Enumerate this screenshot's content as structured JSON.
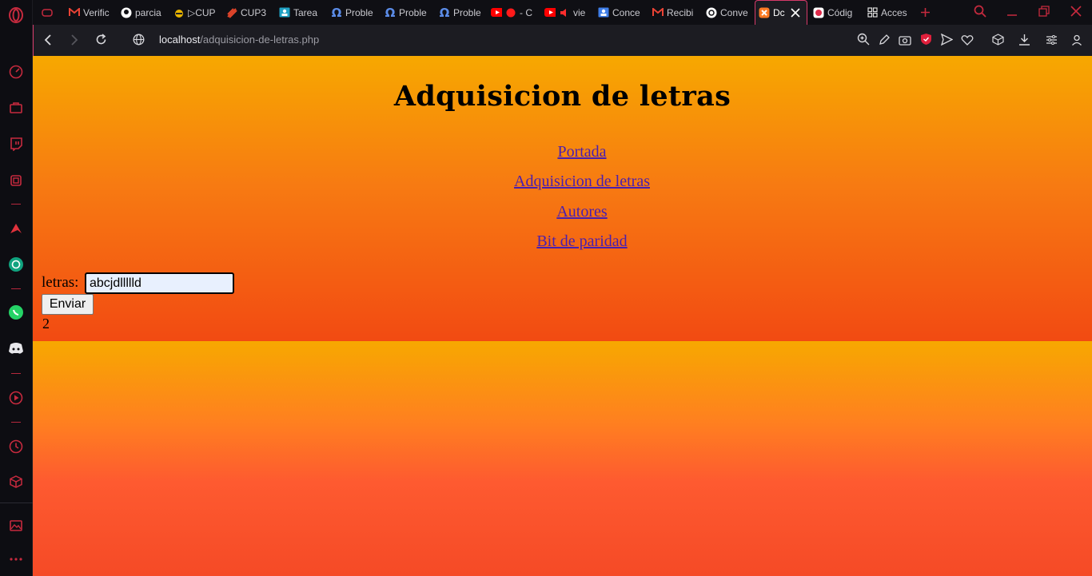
{
  "browser": {
    "tabs": [
      {
        "label": "",
        "icon": "gamepad-icon"
      },
      {
        "label": "Verific",
        "icon": "gmail-icon"
      },
      {
        "label": "parcia",
        "icon": "github-icon"
      },
      {
        "label": "▷CUP",
        "icon": "bee-icon"
      },
      {
        "label": "CUP3",
        "icon": "stack-icon"
      },
      {
        "label": "Tarea",
        "icon": "classroom-icon"
      },
      {
        "label": "Proble",
        "icon": "omega-icon"
      },
      {
        "label": "Proble",
        "icon": "omega-icon"
      },
      {
        "label": "Proble",
        "icon": "omega-icon"
      },
      {
        "label": "- C",
        "icon": "youtube-icon"
      },
      {
        "label": "vie",
        "icon": "youtube-icon"
      },
      {
        "label": "Conce",
        "icon": "classroom-icon"
      },
      {
        "label": "Recibi",
        "icon": "gmail-icon"
      },
      {
        "label": "Conve",
        "icon": "chatgpt-icon"
      },
      {
        "label": "Dc",
        "icon": "xampp-icon",
        "active": true
      },
      {
        "label": "Códig",
        "icon": "codigo-icon"
      },
      {
        "label": "Acces",
        "icon": "grid-icon"
      }
    ],
    "url_host": "localhost",
    "url_path": "/adquisicion-de-letras.php"
  },
  "page": {
    "title": "Adquisicion de letras",
    "nav": [
      "Portada",
      "Adquisicion de letras",
      "Autores",
      "Bit de paridad"
    ],
    "form": {
      "label": "letras:",
      "input_value": "abcjdllllld",
      "submit_label": "Enviar"
    },
    "result": "2"
  },
  "colors": {
    "accent": "#d63a6a",
    "link": "#4a1fae",
    "gradient_top": "#f7a800",
    "gradient_bottom": "#f24a12"
  }
}
